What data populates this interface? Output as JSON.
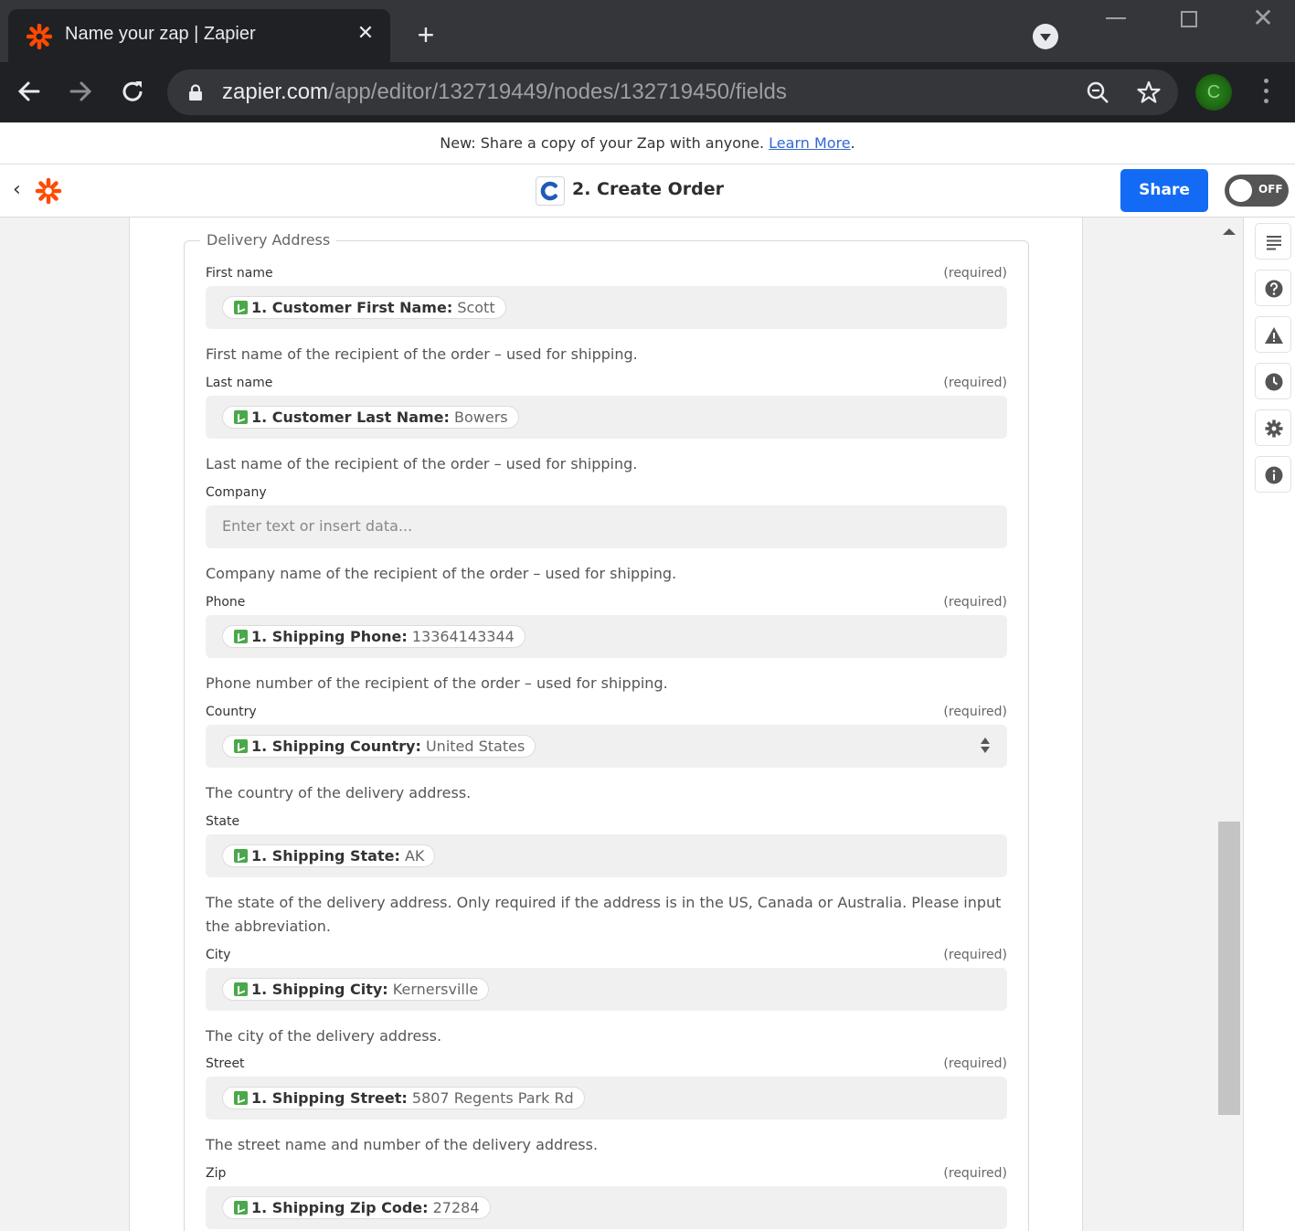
{
  "browser": {
    "tab_title": "Name your zap | Zapier",
    "url_host": "zapier.com",
    "url_path": "/app/editor/132719449/nodes/132719450/fields",
    "profile_initial": "C"
  },
  "announcement": {
    "text": "New: Share a copy of your Zap with anyone. ",
    "link": "Learn More",
    "suffix": "."
  },
  "header": {
    "step_title": "2. Create Order",
    "share_label": "Share",
    "toggle_label": "OFF"
  },
  "section": {
    "legend": "Delivery Address"
  },
  "fields": [
    {
      "label": "First name",
      "required": "(required)",
      "pill_key": "1. Customer First Name:",
      "pill_value": "Scott",
      "help": "First name of the recipient of the order – used for shipping."
    },
    {
      "label": "Last name",
      "required": "(required)",
      "pill_key": "1. Customer Last Name:",
      "pill_value": "Bowers",
      "help": "Last name of the recipient of the order – used for shipping."
    },
    {
      "label": "Company",
      "placeholder": "Enter text or insert data...",
      "help": "Company name of the recipient of the order – used for shipping."
    },
    {
      "label": "Phone",
      "required": "(required)",
      "pill_key": "1. Shipping Phone:",
      "pill_value": "13364143344",
      "help": "Phone number of the recipient of the order – used for shipping."
    },
    {
      "label": "Country",
      "required": "(required)",
      "pill_key": "1. Shipping Country:",
      "pill_value": "United States",
      "help": "The country of the delivery address."
    },
    {
      "label": "State",
      "pill_key": "1. Shipping State:",
      "pill_value": "AK",
      "help": "The state of the delivery address. Only required if the address is in the US, Canada or Australia. Please input the abbreviation."
    },
    {
      "label": "City",
      "required": "(required)",
      "pill_key": "1. Shipping City:",
      "pill_value": "Kernersville",
      "help": "The city of the delivery address."
    },
    {
      "label": "Street",
      "required": "(required)",
      "pill_key": "1. Shipping Street:",
      "pill_value": "5807 Regents Park Rd",
      "help": "The street name and number of the delivery address."
    },
    {
      "label": "Zip",
      "required": "(required)",
      "pill_key": "1. Shipping Zip Code:",
      "pill_value": "27284"
    }
  ],
  "icons": {
    "favicon": "zapier-asterisk-icon",
    "rail": [
      "list-icon",
      "help-icon",
      "warning-icon",
      "clock-icon",
      "gear-icon",
      "info-icon"
    ]
  },
  "colors": {
    "brand": "#ff4a00",
    "share_button": "#136bf5",
    "pill_icon": "#4aa84b"
  }
}
